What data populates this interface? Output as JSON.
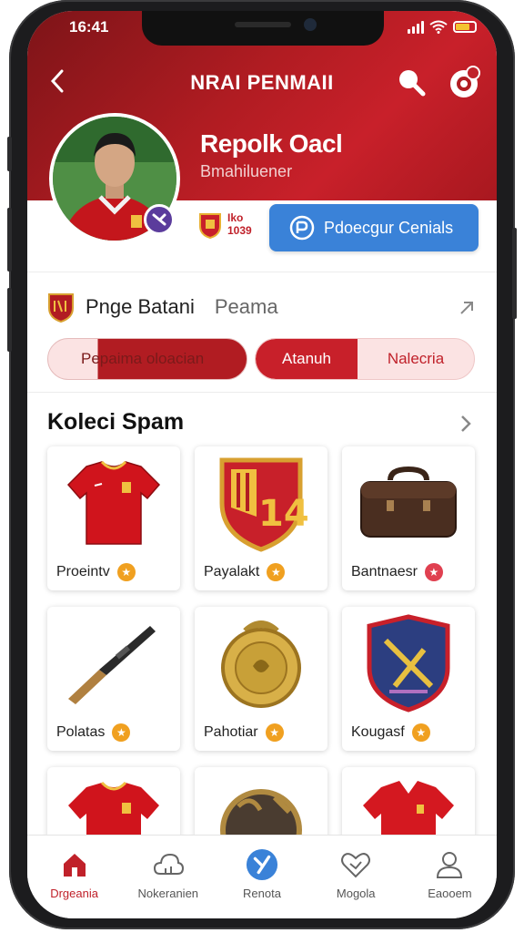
{
  "status": {
    "time": "16:41"
  },
  "topbar": {
    "title": "NRAI PENMAII"
  },
  "profile": {
    "name": "Repolk Oacl",
    "subtitle": "Bmahiluener",
    "club_code_line1": "Iko",
    "club_code_line2": "1039",
    "contact_label": "Pdoecgur Cenials"
  },
  "page_section": {
    "title": "Pnge Batani",
    "subtitle": "Peama",
    "pills": [
      {
        "label": "Pepaima oloacian"
      },
      {
        "label_a": "Atanuh",
        "label_b": "Nalecria"
      }
    ]
  },
  "collection": {
    "title": "Koleci Spam",
    "items": [
      {
        "label": "Proeintv",
        "badge_color": "#f0a020",
        "icon": "red-jersey-icon"
      },
      {
        "label": "Payalakt",
        "badge_color": "#f0a020",
        "icon": "club-crest-icon"
      },
      {
        "label": "Bantnaesr",
        "badge_color": "#e04050",
        "icon": "leather-bag-icon"
      },
      {
        "label": "Polatas",
        "badge_color": "#f0a020",
        "icon": "rifle-icon"
      },
      {
        "label": "Pahotiar",
        "badge_color": "#f0a020",
        "icon": "gold-medal-icon"
      },
      {
        "label": "Kougasf",
        "badge_color": "#f0a020",
        "icon": "blue-shield-icon"
      },
      {
        "label": "",
        "icon": "red-jersey-icon"
      },
      {
        "label": "",
        "icon": "bronze-coin-icon"
      },
      {
        "label": "",
        "icon": "red-polo-icon"
      }
    ]
  },
  "nav": [
    {
      "label": "Drgeania",
      "icon": "home-icon",
      "active": true
    },
    {
      "label": "Nokeranien",
      "icon": "cloud-icon",
      "active": false
    },
    {
      "label": "Renota",
      "icon": "check-circle-icon",
      "active": false
    },
    {
      "label": "Mogola",
      "icon": "heart-icon",
      "active": false
    },
    {
      "label": "Eaooem",
      "icon": "user-icon",
      "active": false
    }
  ],
  "colors": {
    "brand_red": "#b11c22",
    "accent_blue": "#3a82d8"
  }
}
